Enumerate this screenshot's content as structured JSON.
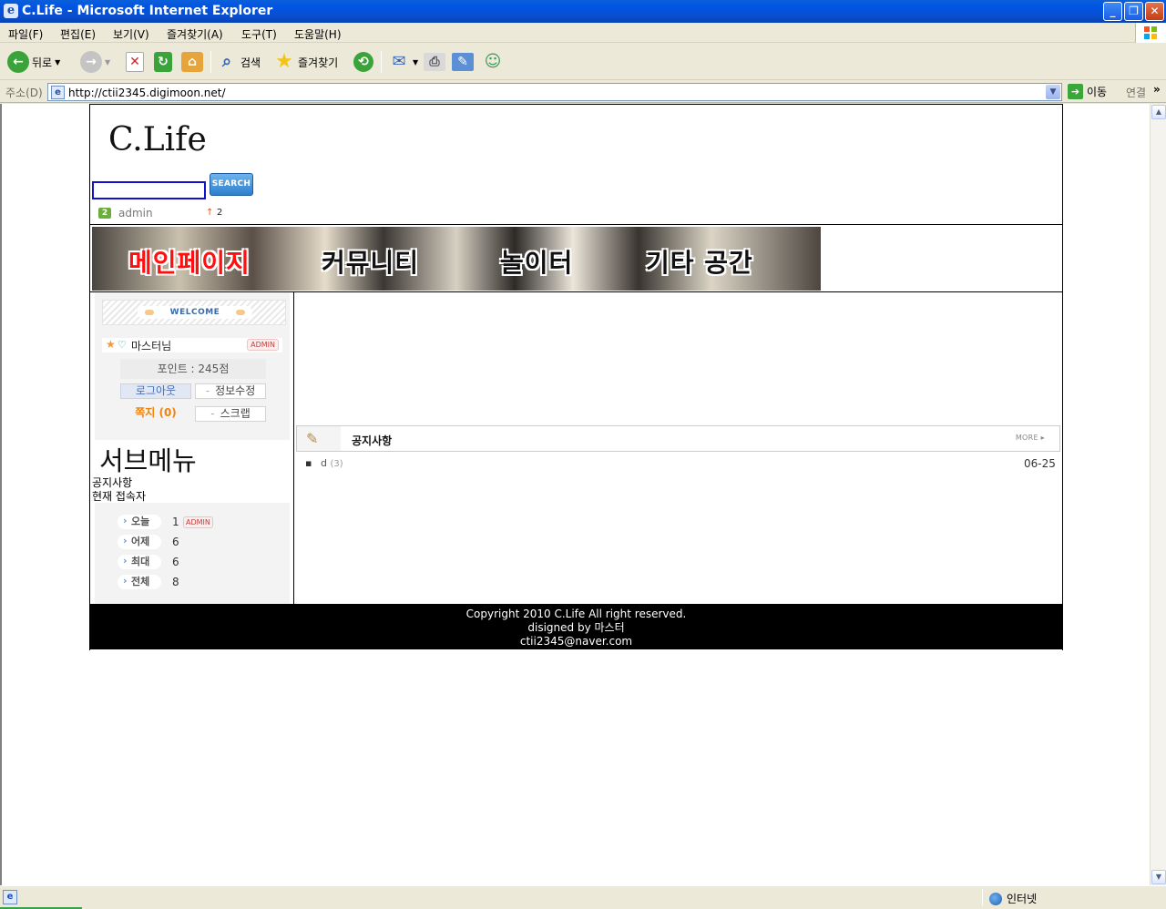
{
  "window": {
    "title": "C.Life - Microsoft Internet Explorer",
    "app_icon": "ie-icon",
    "minimize": "_",
    "maximize": "❐",
    "close": "✕"
  },
  "menubar": {
    "items": [
      "파일(F)",
      "편집(E)",
      "보기(V)",
      "즐겨찾기(A)",
      "도구(T)",
      "도움말(H)"
    ]
  },
  "toolbar": {
    "back_label": "뒤로",
    "search_label": "검색",
    "favorites_label": "즐겨찾기"
  },
  "addressbar": {
    "label": "주소(D)",
    "url": "http://ctii2345.digimoon.net/",
    "go_label": "이동",
    "links_label": "연결"
  },
  "site": {
    "logo": "C.Life",
    "search_button": "SEARCH",
    "search_value": "",
    "admin_level": "2",
    "admin_name": "admin",
    "rank_arrow": "↑",
    "rank_value": "2",
    "nav": [
      "메인페이지",
      "커뮤니티",
      "놀이터",
      "기타 공간"
    ],
    "login": {
      "welcome": "WELCOME",
      "user": "마스터님",
      "user_icon": "♡",
      "admin_tag": "ADMIN",
      "points": "포인트 : 245점",
      "logout": "로그아웃",
      "edit_info": "정보수정",
      "messages": "쪽지 (0)",
      "scrap": "스크랩"
    },
    "submenu": {
      "title": "서브메뉴",
      "links": [
        "공지사항",
        "현재 접속자"
      ]
    },
    "visitors": [
      {
        "label": "오늘",
        "count": "1",
        "tag": "ADMIN"
      },
      {
        "label": "어제",
        "count": "6"
      },
      {
        "label": "최대",
        "count": "6"
      },
      {
        "label": "전체",
        "count": "8"
      }
    ],
    "notice": {
      "title": "공지사항",
      "more": "MORE",
      "items": [
        {
          "title": "d",
          "comments": "(3)",
          "date": "06-25"
        }
      ]
    },
    "footer": {
      "line1": "Copyright 2010 C.Life All right reserved.",
      "line2": "disigned by 마스터",
      "line3": "ctii2345@naver.com"
    }
  },
  "statusbar": {
    "zone": "인터넷"
  }
}
